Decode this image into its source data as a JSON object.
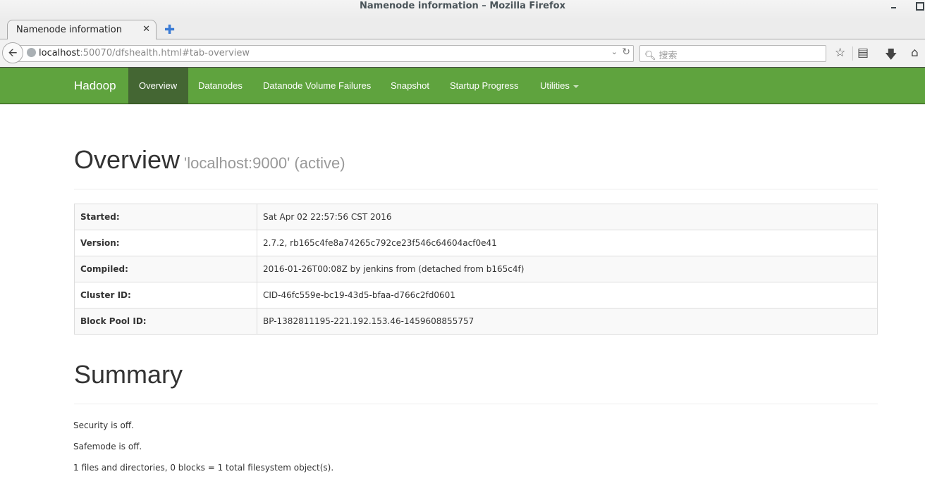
{
  "window": {
    "title": "Namenode information – Mozilla Firefox"
  },
  "browser": {
    "tab_title": "Namenode information",
    "url_host": "localhost",
    "url_rest": ":50070/dfshealth.html#tab-overview",
    "search_placeholder": "搜索"
  },
  "hadoop_nav": {
    "brand": "Hadoop",
    "items": [
      {
        "label": "Overview",
        "active": true
      },
      {
        "label": "Datanodes"
      },
      {
        "label": "Datanode Volume Failures"
      },
      {
        "label": "Snapshot"
      },
      {
        "label": "Startup Progress"
      },
      {
        "label": "Utilities"
      }
    ]
  },
  "overview": {
    "title": "Overview",
    "subtitle": "'localhost:9000' (active)",
    "rows": [
      {
        "label": "Started:",
        "value": "Sat Apr 02 22:57:56 CST 2016"
      },
      {
        "label": "Version:",
        "value": "2.7.2, rb165c4fe8a74265c792ce23f546c64604acf0e41"
      },
      {
        "label": "Compiled:",
        "value": "2016-01-26T00:08Z by jenkins from (detached from b165c4f)"
      },
      {
        "label": "Cluster ID:",
        "value": "CID-46fc559e-bc19-43d5-bfaa-d766c2fd0601"
      },
      {
        "label": "Block Pool ID:",
        "value": "BP-1382811195-221.192.153.46-1459608855757"
      }
    ]
  },
  "summary": {
    "title": "Summary",
    "lines": [
      "Security is off.",
      "Safemode is off.",
      "1 files and directories, 0 blocks = 1 total filesystem object(s)."
    ]
  }
}
